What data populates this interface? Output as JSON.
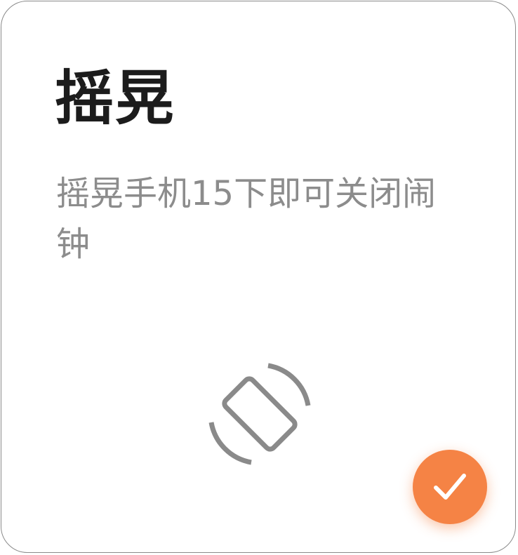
{
  "card": {
    "title": "摇晃",
    "description": "摇晃手机15下即可关闭闹钟"
  },
  "icons": {
    "shake": "phone-rotate-icon",
    "confirm": "check-icon"
  },
  "colors": {
    "accent": "#f58345",
    "title": "#1c1c1c",
    "description": "#8c8c8c",
    "icon": "#8a8a8a"
  }
}
